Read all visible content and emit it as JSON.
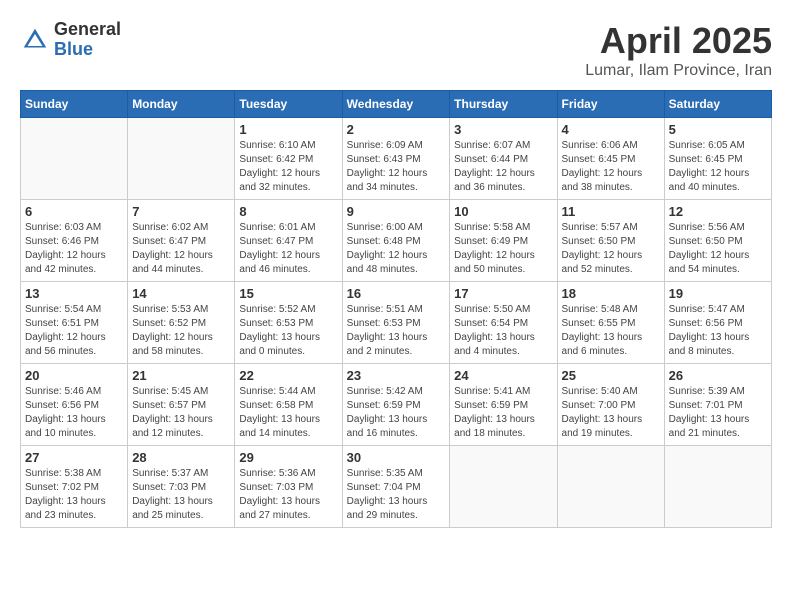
{
  "logo": {
    "general": "General",
    "blue": "Blue"
  },
  "title": "April 2025",
  "location": "Lumar, Ilam Province, Iran",
  "days_of_week": [
    "Sunday",
    "Monday",
    "Tuesday",
    "Wednesday",
    "Thursday",
    "Friday",
    "Saturday"
  ],
  "weeks": [
    [
      {
        "day": "",
        "detail": ""
      },
      {
        "day": "",
        "detail": ""
      },
      {
        "day": "1",
        "detail": "Sunrise: 6:10 AM\nSunset: 6:42 PM\nDaylight: 12 hours\nand 32 minutes."
      },
      {
        "day": "2",
        "detail": "Sunrise: 6:09 AM\nSunset: 6:43 PM\nDaylight: 12 hours\nand 34 minutes."
      },
      {
        "day": "3",
        "detail": "Sunrise: 6:07 AM\nSunset: 6:44 PM\nDaylight: 12 hours\nand 36 minutes."
      },
      {
        "day": "4",
        "detail": "Sunrise: 6:06 AM\nSunset: 6:45 PM\nDaylight: 12 hours\nand 38 minutes."
      },
      {
        "day": "5",
        "detail": "Sunrise: 6:05 AM\nSunset: 6:45 PM\nDaylight: 12 hours\nand 40 minutes."
      }
    ],
    [
      {
        "day": "6",
        "detail": "Sunrise: 6:03 AM\nSunset: 6:46 PM\nDaylight: 12 hours\nand 42 minutes."
      },
      {
        "day": "7",
        "detail": "Sunrise: 6:02 AM\nSunset: 6:47 PM\nDaylight: 12 hours\nand 44 minutes."
      },
      {
        "day": "8",
        "detail": "Sunrise: 6:01 AM\nSunset: 6:47 PM\nDaylight: 12 hours\nand 46 minutes."
      },
      {
        "day": "9",
        "detail": "Sunrise: 6:00 AM\nSunset: 6:48 PM\nDaylight: 12 hours\nand 48 minutes."
      },
      {
        "day": "10",
        "detail": "Sunrise: 5:58 AM\nSunset: 6:49 PM\nDaylight: 12 hours\nand 50 minutes."
      },
      {
        "day": "11",
        "detail": "Sunrise: 5:57 AM\nSunset: 6:50 PM\nDaylight: 12 hours\nand 52 minutes."
      },
      {
        "day": "12",
        "detail": "Sunrise: 5:56 AM\nSunset: 6:50 PM\nDaylight: 12 hours\nand 54 minutes."
      }
    ],
    [
      {
        "day": "13",
        "detail": "Sunrise: 5:54 AM\nSunset: 6:51 PM\nDaylight: 12 hours\nand 56 minutes."
      },
      {
        "day": "14",
        "detail": "Sunrise: 5:53 AM\nSunset: 6:52 PM\nDaylight: 12 hours\nand 58 minutes."
      },
      {
        "day": "15",
        "detail": "Sunrise: 5:52 AM\nSunset: 6:53 PM\nDaylight: 13 hours\nand 0 minutes."
      },
      {
        "day": "16",
        "detail": "Sunrise: 5:51 AM\nSunset: 6:53 PM\nDaylight: 13 hours\nand 2 minutes."
      },
      {
        "day": "17",
        "detail": "Sunrise: 5:50 AM\nSunset: 6:54 PM\nDaylight: 13 hours\nand 4 minutes."
      },
      {
        "day": "18",
        "detail": "Sunrise: 5:48 AM\nSunset: 6:55 PM\nDaylight: 13 hours\nand 6 minutes."
      },
      {
        "day": "19",
        "detail": "Sunrise: 5:47 AM\nSunset: 6:56 PM\nDaylight: 13 hours\nand 8 minutes."
      }
    ],
    [
      {
        "day": "20",
        "detail": "Sunrise: 5:46 AM\nSunset: 6:56 PM\nDaylight: 13 hours\nand 10 minutes."
      },
      {
        "day": "21",
        "detail": "Sunrise: 5:45 AM\nSunset: 6:57 PM\nDaylight: 13 hours\nand 12 minutes."
      },
      {
        "day": "22",
        "detail": "Sunrise: 5:44 AM\nSunset: 6:58 PM\nDaylight: 13 hours\nand 14 minutes."
      },
      {
        "day": "23",
        "detail": "Sunrise: 5:42 AM\nSunset: 6:59 PM\nDaylight: 13 hours\nand 16 minutes."
      },
      {
        "day": "24",
        "detail": "Sunrise: 5:41 AM\nSunset: 6:59 PM\nDaylight: 13 hours\nand 18 minutes."
      },
      {
        "day": "25",
        "detail": "Sunrise: 5:40 AM\nSunset: 7:00 PM\nDaylight: 13 hours\nand 19 minutes."
      },
      {
        "day": "26",
        "detail": "Sunrise: 5:39 AM\nSunset: 7:01 PM\nDaylight: 13 hours\nand 21 minutes."
      }
    ],
    [
      {
        "day": "27",
        "detail": "Sunrise: 5:38 AM\nSunset: 7:02 PM\nDaylight: 13 hours\nand 23 minutes."
      },
      {
        "day": "28",
        "detail": "Sunrise: 5:37 AM\nSunset: 7:03 PM\nDaylight: 13 hours\nand 25 minutes."
      },
      {
        "day": "29",
        "detail": "Sunrise: 5:36 AM\nSunset: 7:03 PM\nDaylight: 13 hours\nand 27 minutes."
      },
      {
        "day": "30",
        "detail": "Sunrise: 5:35 AM\nSunset: 7:04 PM\nDaylight: 13 hours\nand 29 minutes."
      },
      {
        "day": "",
        "detail": ""
      },
      {
        "day": "",
        "detail": ""
      },
      {
        "day": "",
        "detail": ""
      }
    ]
  ]
}
